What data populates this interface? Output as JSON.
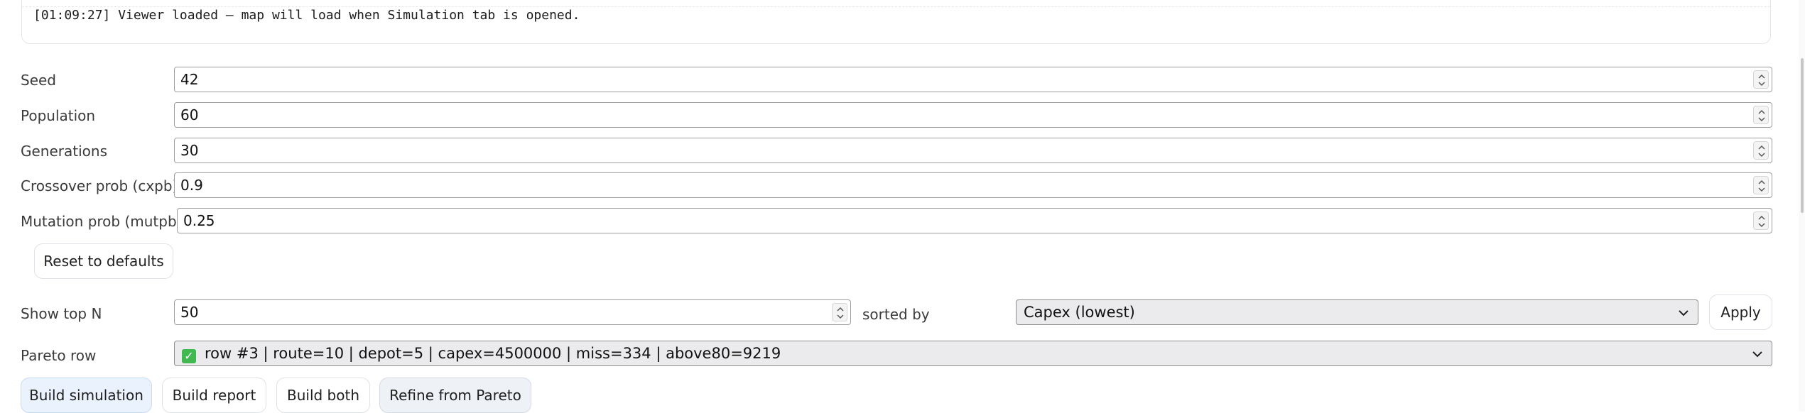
{
  "log": {
    "message": "[01:09:27] Viewer loaded – map will load when Simulation tab is opened."
  },
  "params": [
    {
      "key": "seed",
      "label": "Seed",
      "value": "42"
    },
    {
      "key": "population",
      "label": "Population",
      "value": "60"
    },
    {
      "key": "generations",
      "label": "Generations",
      "value": "30"
    },
    {
      "key": "cxpb",
      "label": "Crossover prob (cxpb)",
      "value": "0.9"
    },
    {
      "key": "mutpb",
      "label": "Mutation prob (mutpb)",
      "value": "0.25"
    }
  ],
  "reset_button": "Reset to defaults",
  "top_n": {
    "label": "Show top N",
    "value": "50",
    "sorted_by_label": "sorted by",
    "sort_selected": "Capex (lowest)",
    "apply_label": "Apply"
  },
  "pareto": {
    "label": "Pareto row",
    "selected": "row #3 | route=10 | depot=5 | capex=4500000 | miss=334 | above80=9219",
    "status_icon": "check-icon"
  },
  "actions": {
    "build_simulation": "Build simulation",
    "build_report": "Build report",
    "build_both": "Build both",
    "refine_from_pareto": "Refine from Pareto"
  },
  "colors": {
    "primary_button_bg": "#e9f2fd",
    "check_green": "#3fb950"
  }
}
